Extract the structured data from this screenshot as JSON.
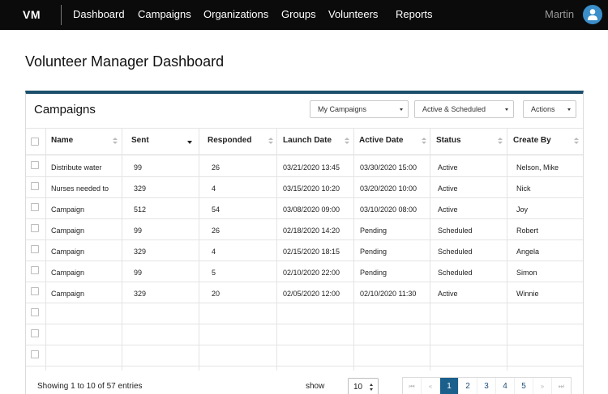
{
  "app": {
    "logo": "VM",
    "nav": [
      "Dashboard",
      "Campaigns",
      "Organizations",
      "Groups",
      "Volunteers",
      "Reports"
    ],
    "user_name": "Martin"
  },
  "page": {
    "title": "Volunteer Manager Dashboard"
  },
  "panel": {
    "title": "Campaigns",
    "filters": {
      "campaign_filter": "My Campaigns",
      "status_filter": "Active & Scheduled",
      "actions": "Actions"
    }
  },
  "table": {
    "columns": [
      "Name",
      "Sent",
      "Responded",
      "Launch Date",
      "Active Date",
      "Status",
      "Create By"
    ],
    "sorted_column": "Sent",
    "rows": [
      [
        "Distribute water",
        "99",
        "26",
        "03/21/2020 13:45",
        "03/30/2020 15:00",
        "Active",
        "Nelson, Mike"
      ],
      [
        "Nurses needed to",
        "329",
        "4",
        "03/15/2020 10:20",
        "03/20/2020 10:00",
        "Active",
        "Nick"
      ],
      [
        "Campaign",
        "512",
        "54",
        "03/08/2020 09:00",
        "03/10/2020 08:00",
        "Active",
        "Joy"
      ],
      [
        "Campaign",
        "99",
        "26",
        "02/18/2020 14:20",
        "Pending",
        "Scheduled",
        "Robert"
      ],
      [
        "Campaign",
        "329",
        "4",
        "02/15/2020 18:15",
        "Pending",
        "Scheduled",
        "Angela"
      ],
      [
        "Campaign",
        "99",
        "5",
        "02/10/2020 22:00",
        "Pending",
        "Scheduled",
        "Simon"
      ],
      [
        "Campaign",
        "329",
        "20",
        "02/05/2020 12:00",
        "02/10/2020 11:30",
        "Active",
        "Winnie"
      ]
    ],
    "empty_rows": 3
  },
  "footer": {
    "showing": "Showing  1 to 10 of 57 entries",
    "show_label": "show",
    "page_size": "10",
    "pager": {
      "first": "⏮",
      "prev": "«",
      "pages": [
        "1",
        "2",
        "3",
        "4",
        "5"
      ],
      "current": "1",
      "next": "»",
      "last": "⏭"
    }
  },
  "colors": {
    "topbar": "#0b0b0b",
    "accent": "#1b4f6b",
    "avatar": "#3a8ec9",
    "pager_active": "#1b5f8c"
  }
}
